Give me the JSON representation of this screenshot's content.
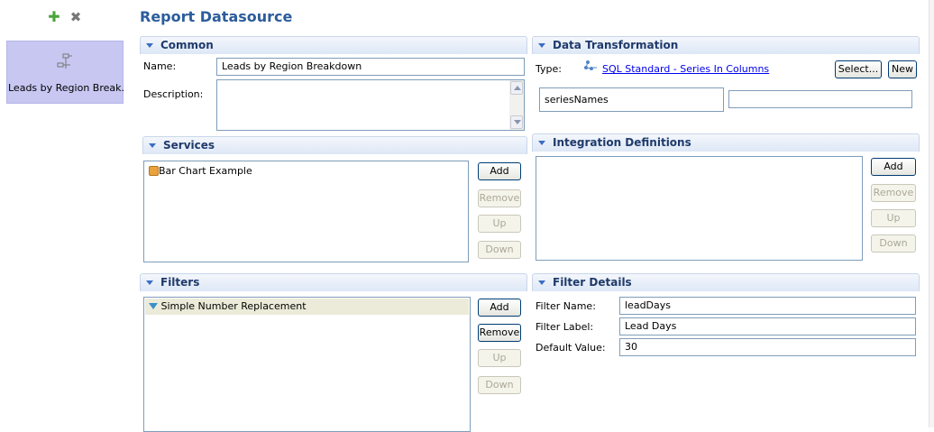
{
  "toolbar": {
    "add_icon": "plus-icon",
    "remove_icon": "x-icon"
  },
  "datasource_list": {
    "items": [
      {
        "label": "Leads by Region Break...",
        "icon": "datasource-icon"
      }
    ]
  },
  "page": {
    "title": "Report Datasource"
  },
  "common": {
    "header": "Common",
    "name_label": "Name:",
    "name_value": "Leads by Region Breakdown",
    "description_label": "Description:",
    "description_value": ""
  },
  "services": {
    "header": "Services",
    "items": [
      {
        "label": "Bar Chart Example",
        "icon": "service-icon"
      }
    ],
    "buttons": {
      "add": "Add",
      "remove": "Remove",
      "up": "Up",
      "down": "Down"
    }
  },
  "filters": {
    "header": "Filters",
    "items": [
      {
        "label": "Simple Number Replacement",
        "icon": "filter-icon"
      }
    ],
    "buttons": {
      "add": "Add",
      "remove": "Remove",
      "up": "Up",
      "down": "Down"
    }
  },
  "data_transformation": {
    "header": "Data Transformation",
    "type_label": "Type:",
    "type_value": "SQL Standard - Series In Columns",
    "select_button": "Select...",
    "new_button": "New",
    "param_name": "seriesNames",
    "param_value": ""
  },
  "integration_definitions": {
    "header": "Integration Definitions",
    "buttons": {
      "add": "Add",
      "remove": "Remove",
      "up": "Up",
      "down": "Down"
    }
  },
  "filter_details": {
    "header": "Filter Details",
    "filter_name_label": "Filter Name:",
    "filter_name_value": "leadDays",
    "filter_label_label": "Filter Label:",
    "filter_label_value": "Lead Days",
    "default_value_label": "Default Value:",
    "default_value_value": "30"
  },
  "colors": {
    "title": "#2c5c9b",
    "selection": "#c7c7f2",
    "link": "#0000ee"
  }
}
